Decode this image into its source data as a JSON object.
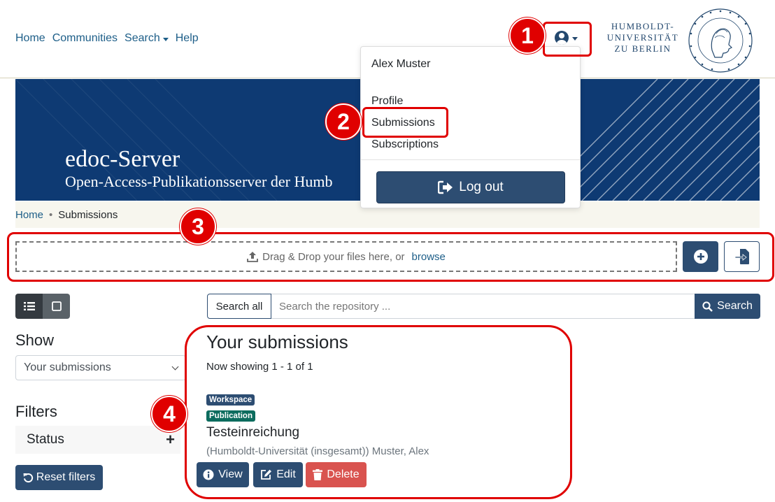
{
  "nav": {
    "home": "Home",
    "communities": "Communities",
    "search": "Search",
    "help": "Help"
  },
  "logo": {
    "line1": "HUMBOLDT-",
    "line2": "UNIVERSITÄT",
    "line3": "ZU BERLIN"
  },
  "banner": {
    "title": "edoc-Server",
    "subtitle": "Open-Access-Publikationsserver der Humb"
  },
  "user_menu": {
    "name": "Alex Muster",
    "items": [
      "Profile",
      "Submissions",
      "Subscriptions"
    ],
    "logout": "Log out"
  },
  "breadcrumb": {
    "home": "Home",
    "separator": "•",
    "current": "Submissions"
  },
  "upload": {
    "text": "Drag & Drop your files here, or",
    "browse": "browse"
  },
  "search": {
    "scope": "Search all",
    "placeholder": "Search the repository ...",
    "button": "Search"
  },
  "sidebar": {
    "show_label": "Show",
    "show_selected": "Your submissions",
    "filters_label": "Filters",
    "status_label": "Status",
    "status_toggle": "+",
    "reset": "Reset filters"
  },
  "results": {
    "title": "Your submissions",
    "count": "Now showing 1 - 1 of 1",
    "item": {
      "badge_workspace": "Workspace",
      "badge_publication": "Publication",
      "title": "Testeinreichung",
      "author": "(Humboldt-Universität (insgesamt)) Muster, Alex",
      "view": "View",
      "edit": "Edit",
      "delete": "Delete"
    }
  },
  "annotations": [
    "1",
    "2",
    "3",
    "4"
  ],
  "colors": {
    "primary": "#2d4d72",
    "link": "#1d5e88",
    "banner": "#0e3a73",
    "danger": "#d9534f",
    "publication": "#0c6c5e",
    "annotation": "#e00000"
  }
}
